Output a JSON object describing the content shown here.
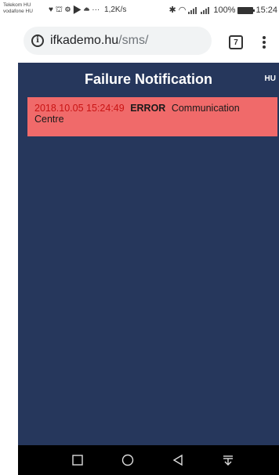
{
  "status_bar": {
    "carrier_1": "Telekom HU",
    "carrier_2": "vodafone HU",
    "notification_icons": "♥ ⛫ ⚙ ▶ ☁ ···",
    "speed": "1,2K/s",
    "battery": "100%",
    "time": "15:24"
  },
  "browser": {
    "url_host": "ifkademo.hu",
    "url_path": "/sms/",
    "tab_count": "7"
  },
  "app": {
    "title": "Failure Notification",
    "language": "HU",
    "notifications": [
      {
        "timestamp": "2018.10.05 15:24:49",
        "level": "ERROR",
        "message": "Communication Centre"
      }
    ],
    "colors": {
      "background": "#26375c",
      "notification_error": "#f06a6a",
      "timestamp_text": "#c91414"
    }
  },
  "nav": {
    "icons": [
      "recent-apps-icon",
      "home-icon",
      "back-icon",
      "notification-pull-icon"
    ]
  }
}
